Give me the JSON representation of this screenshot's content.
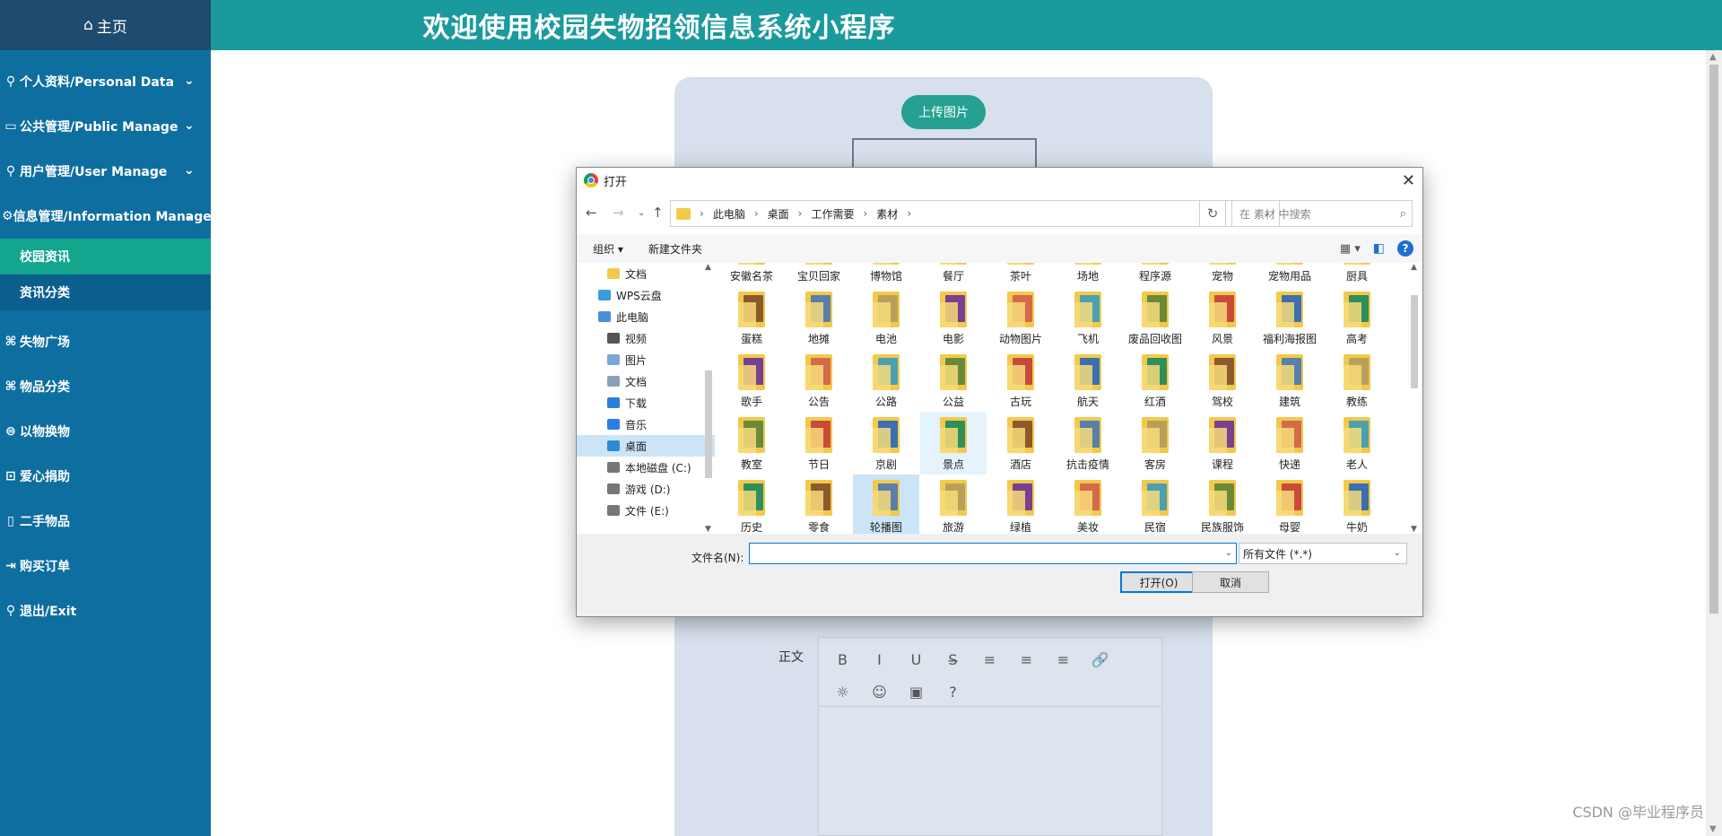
{
  "header": {
    "title": "欢迎使用校园失物招领信息系统小程序"
  },
  "sidebar": {
    "home": "主页",
    "items": [
      {
        "label": "个人资料/Personal Data",
        "icon": "user-icon",
        "chevron": true
      },
      {
        "label": "公共管理/Public Manage",
        "icon": "monitor-icon",
        "chevron": true
      },
      {
        "label": "用户管理/User Manage",
        "icon": "user-icon",
        "chevron": true
      },
      {
        "label": "信息管理/Information Manage",
        "icon": "gear-icon",
        "chevron": true
      }
    ],
    "sub_items": [
      {
        "label": "校园资讯",
        "active": true
      },
      {
        "label": "资讯分类",
        "active": false
      }
    ],
    "items2": [
      {
        "label": "失物广场",
        "icon": "tag-icon"
      },
      {
        "label": "物品分类",
        "icon": "tag-icon"
      },
      {
        "label": "以物换物",
        "icon": "exchange-icon"
      },
      {
        "label": "爱心捐助",
        "icon": "heart-icon"
      },
      {
        "label": "二手物品",
        "icon": "phone-icon"
      },
      {
        "label": "购买订单",
        "icon": "exit-icon"
      },
      {
        "label": "退出/Exit",
        "icon": "user-icon"
      }
    ]
  },
  "content": {
    "upload_label": "上传图片",
    "editor_label": "正文",
    "toolbar": [
      "B",
      "I",
      "U",
      "S̶",
      "≡",
      "≡",
      "≡",
      "🔗"
    ],
    "toolbar2": [
      "☼",
      "☺",
      "▣",
      "?"
    ]
  },
  "watermark": "CSDN @毕业程序员",
  "dialog": {
    "title": "打开",
    "breadcrumbs": [
      "此电脑",
      "桌面",
      "工作需要",
      "素材"
    ],
    "search_placeholder": "在 素材 中搜索",
    "organize": "组织 ▾",
    "new_folder": "新建文件夹",
    "nav_items": [
      {
        "label": "文档",
        "indent": 1,
        "color": "#f3c94c"
      },
      {
        "label": "WPS云盘",
        "indent": 0,
        "color": "#3b9be0"
      },
      {
        "label": "此电脑",
        "indent": 0,
        "color": "#4a90d9"
      },
      {
        "label": "视频",
        "indent": 1,
        "color": "#555"
      },
      {
        "label": "图片",
        "indent": 1,
        "color": "#7aa7d8"
      },
      {
        "label": "文档",
        "indent": 1,
        "color": "#8aa0b8"
      },
      {
        "label": "下载",
        "indent": 1,
        "color": "#2b7de0"
      },
      {
        "label": "音乐",
        "indent": 1,
        "color": "#2b7de0"
      },
      {
        "label": "桌面",
        "indent": 1,
        "color": "#2b8ad8",
        "selected": true
      },
      {
        "label": "本地磁盘 (C:)",
        "indent": 1,
        "color": "#777"
      },
      {
        "label": "游戏 (D:)",
        "indent": 1,
        "color": "#777"
      },
      {
        "label": "文件 (E:)",
        "indent": 1,
        "color": "#777"
      }
    ],
    "folders": [
      [
        "安徽名茶",
        "宝贝回家",
        "博物馆",
        "餐厅",
        "茶叶",
        "场地",
        "程序源",
        "宠物",
        "宠物用品",
        "厨具"
      ],
      [
        "蛋糕",
        "地摊",
        "电池",
        "电影",
        "动物图片",
        "飞机",
        "废品回收图",
        "风景",
        "福利海报图",
        "高考"
      ],
      [
        "歌手",
        "公告",
        "公路",
        "公益",
        "古玩",
        "航天",
        "红酒",
        "驾校",
        "建筑",
        "教练"
      ],
      [
        "教室",
        "节日",
        "京剧",
        "景点",
        "酒店",
        "抗击疫情",
        "客房",
        "课程",
        "快递",
        "老人"
      ],
      [
        "历史",
        "零食",
        "轮播图",
        "旅游",
        "绿植",
        "美妆",
        "民宿",
        "民族服饰",
        "母婴",
        "牛奶"
      ]
    ],
    "selected_folder": "轮播图",
    "hover_folder": "景点",
    "filename_label": "文件名(N):",
    "filename_value": "",
    "filetype": "所有文件 (*.*)",
    "open_btn": "打开(O)",
    "cancel_btn": "取消"
  },
  "colors": {
    "sidebar": "#0e6ea0",
    "header": "#1a9a9d",
    "active_sub": "#13a58e",
    "upload_btn": "#26a191"
  }
}
